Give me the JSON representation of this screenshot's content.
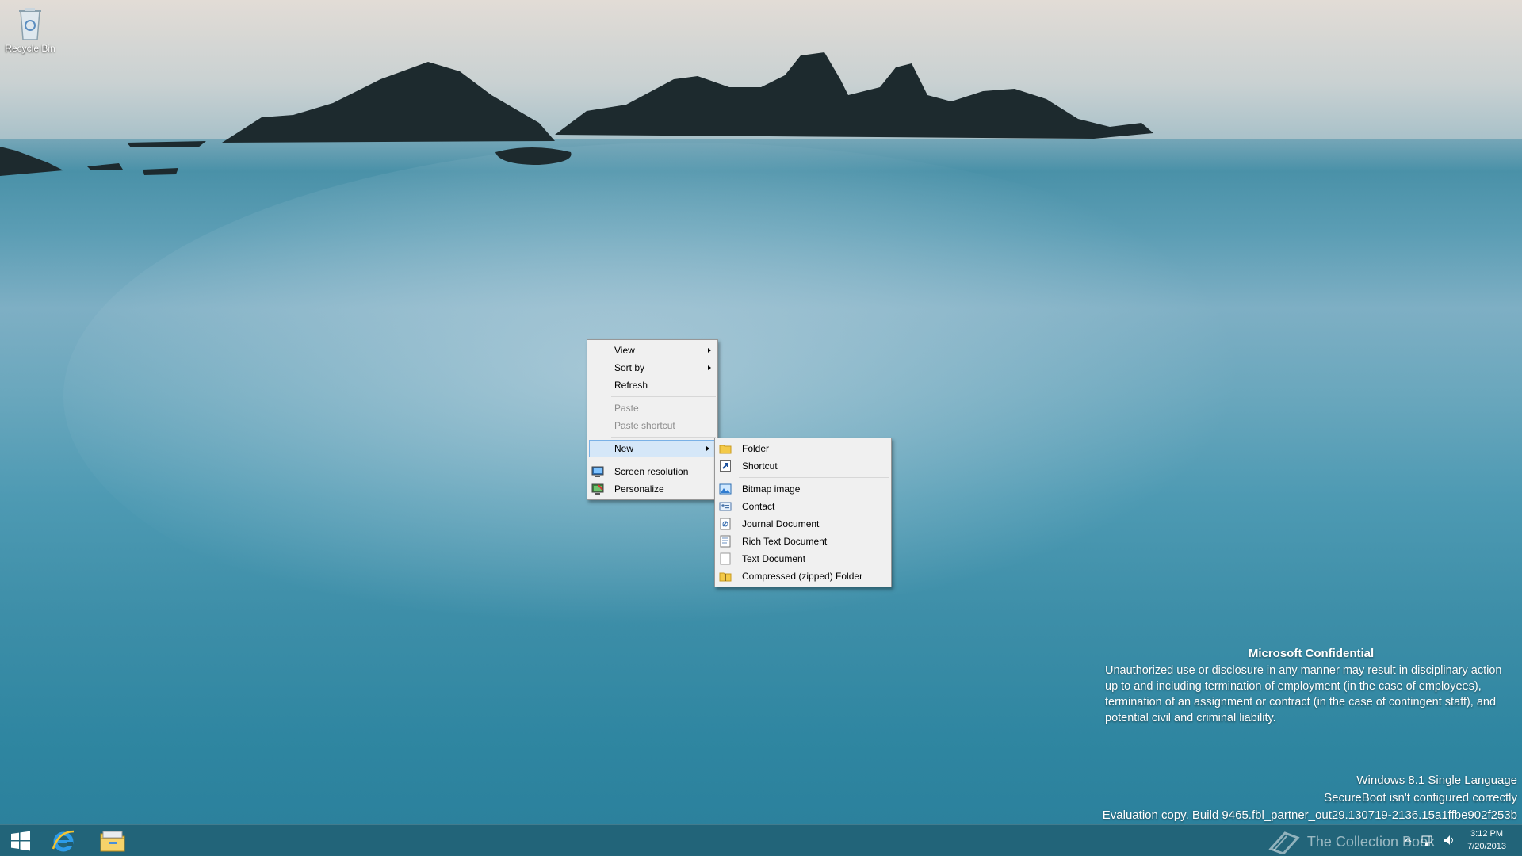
{
  "desktop": {
    "icons": [
      {
        "label": "Recycle Bin",
        "icon": "recycle-bin-icon"
      }
    ]
  },
  "context_menu": {
    "items": [
      {
        "label": "View",
        "submenu": true
      },
      {
        "label": "Sort by",
        "submenu": true
      },
      {
        "label": "Refresh"
      },
      {
        "label": "Paste",
        "disabled": true
      },
      {
        "label": "Paste shortcut",
        "disabled": true
      },
      {
        "label": "New",
        "submenu": true,
        "highlighted": true
      },
      {
        "label": "Screen resolution",
        "icon": "screen-resolution-icon"
      },
      {
        "label": "Personalize",
        "icon": "personalize-icon"
      }
    ]
  },
  "new_submenu": {
    "items": [
      {
        "label": "Folder",
        "icon": "folder-icon"
      },
      {
        "label": "Shortcut",
        "icon": "shortcut-icon"
      },
      {
        "label": "Bitmap image",
        "icon": "bitmap-image-icon"
      },
      {
        "label": "Contact",
        "icon": "contact-icon"
      },
      {
        "label": "Journal Document",
        "icon": "journal-document-icon"
      },
      {
        "label": "Rich Text Document",
        "icon": "rich-text-document-icon"
      },
      {
        "label": "Text Document",
        "icon": "text-document-icon"
      },
      {
        "label": "Compressed (zipped) Folder",
        "icon": "zipped-folder-icon"
      }
    ]
  },
  "confidential": {
    "title": "Microsoft Confidential",
    "body": "Unauthorized use or disclosure in any manner may result in disciplinary action up to and including termination of employment (in the case of employees), termination of an assignment or contract (in the case of contingent staff), and potential civil and criminal liability."
  },
  "watermark": {
    "edition": "Windows 8.1 Single Language",
    "secureboot": "SecureBoot isn't configured correctly",
    "build": "Evaluation copy. Build 9465.fbl_partner_out29.130719-2136.15a1ffbe902f253b"
  },
  "taskbar": {
    "pinned": [
      "start-icon",
      "internet-explorer-icon",
      "file-explorer-icon"
    ],
    "overlay_text": "The Collection Book",
    "time": "3:12 PM",
    "date": "7/20/2013"
  },
  "colors": {
    "taskbar": "#205c70",
    "menu_bg": "#f0f0f0",
    "highlight": "#d5e7f8",
    "highlight_border": "#7ab1e6",
    "disabled_text": "#8d8d8d"
  }
}
